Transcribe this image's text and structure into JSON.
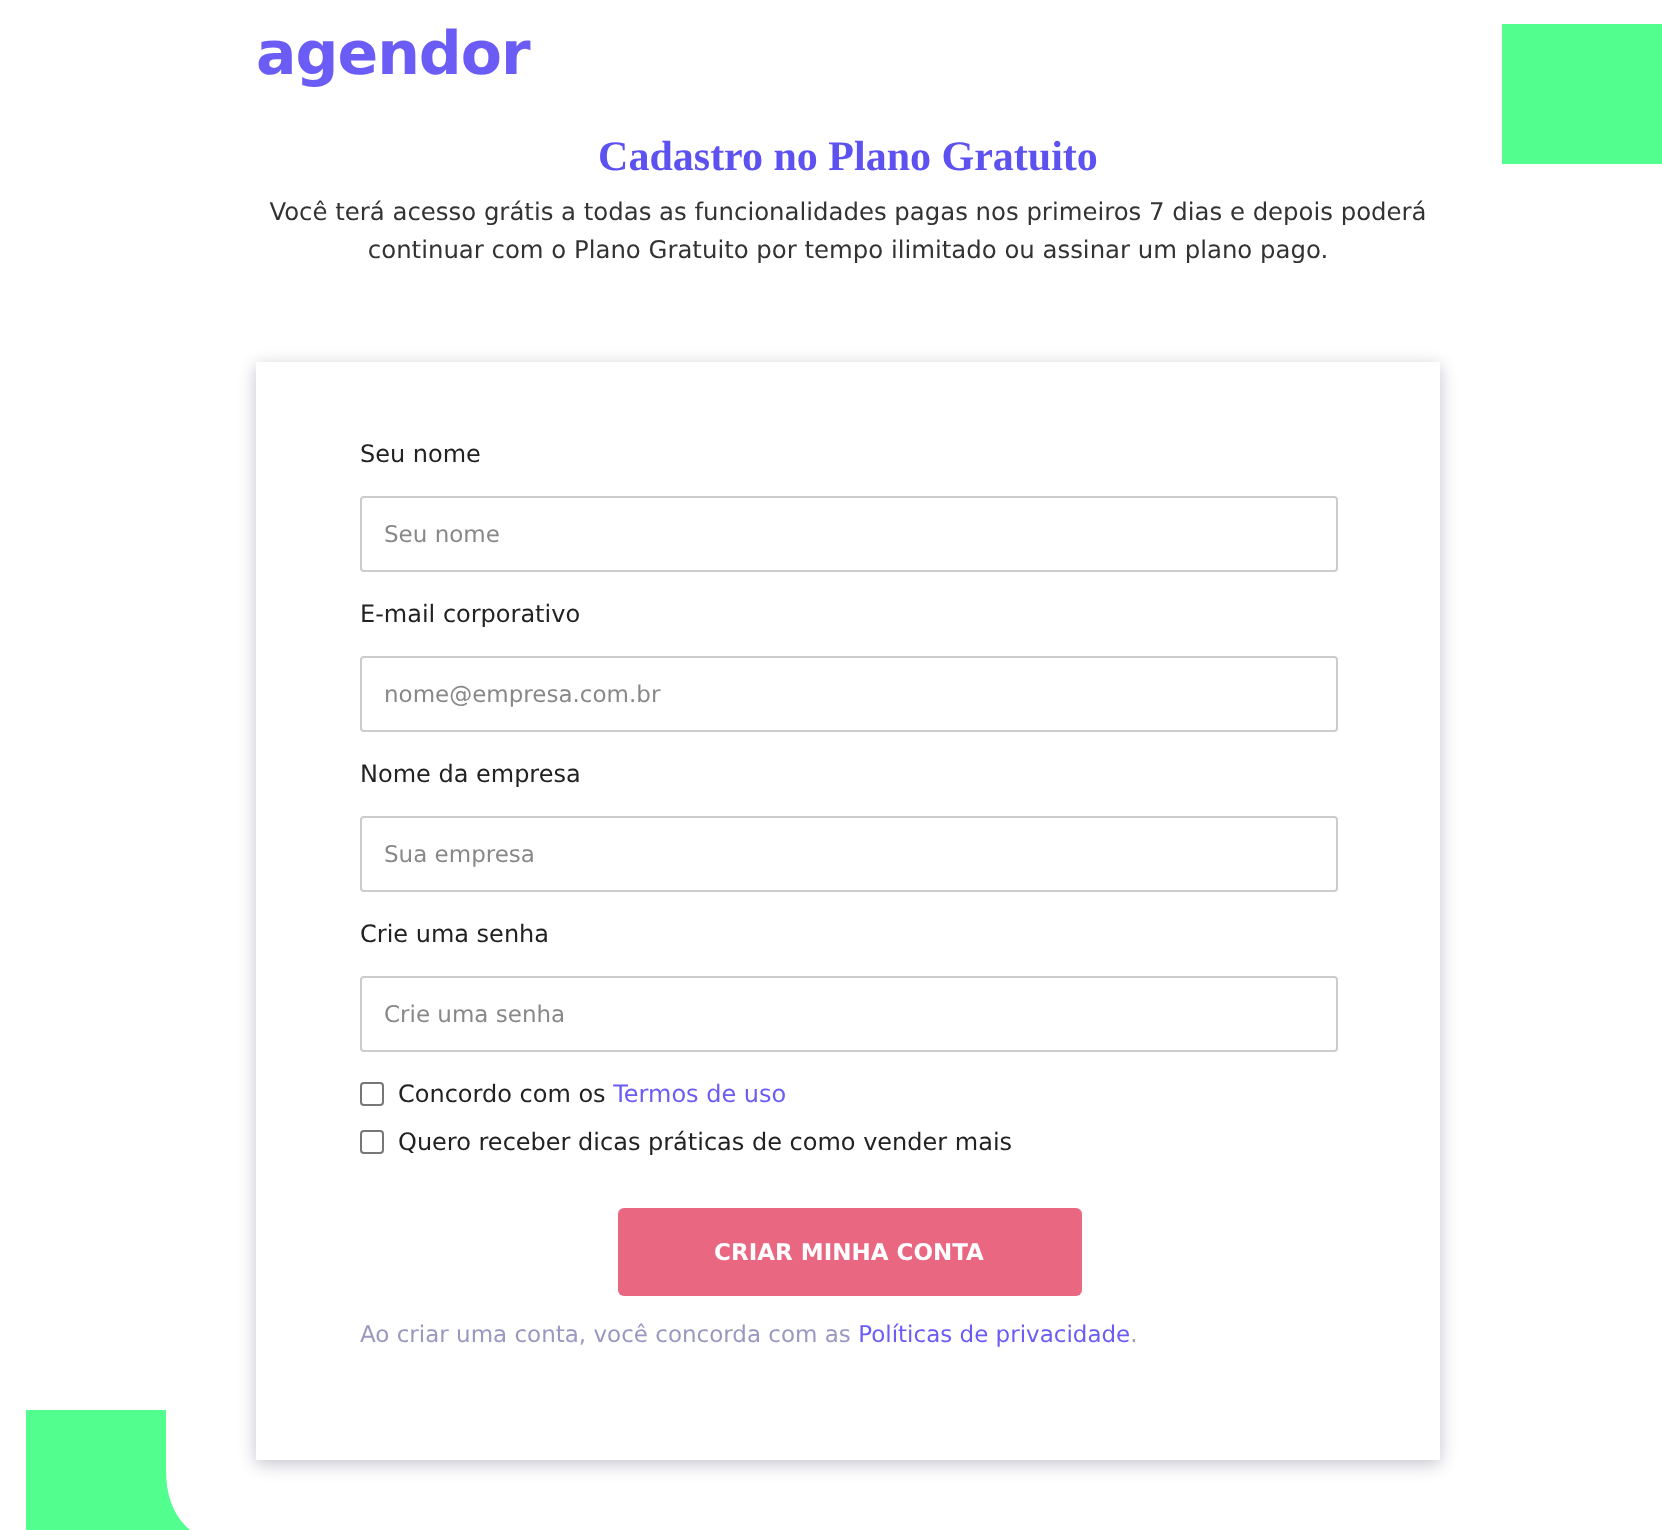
{
  "logo": "agendor",
  "title": "Cadastro no Plano Gratuito",
  "subtitle": "Você terá acesso grátis a todas as funcionalidades pagas nos primeiros 7 dias e depois poderá continuar com o Plano Gratuito por tempo ilimitado ou assinar um plano pago.",
  "fields": [
    {
      "label": "Seu nome",
      "placeholder": "Seu nome"
    },
    {
      "label": "E-mail corporativo",
      "placeholder": "nome@empresa.com.br"
    },
    {
      "label": "Nome da empresa",
      "placeholder": "Sua empresa"
    },
    {
      "label": "Crie uma senha",
      "placeholder": "Crie uma senha"
    }
  ],
  "checkboxes": [
    {
      "text": "Concordo com os ",
      "link": "Termos de uso",
      "checked": false
    },
    {
      "text": "Quero receber dicas práticas de como vender mais",
      "checked": false
    }
  ],
  "submit_button": "CRIAR MINHA CONTA",
  "privacy_note": {
    "text": "Ao criar uma conta, você concorda com as ",
    "link": "Políticas de privacidade",
    "end": "."
  }
}
